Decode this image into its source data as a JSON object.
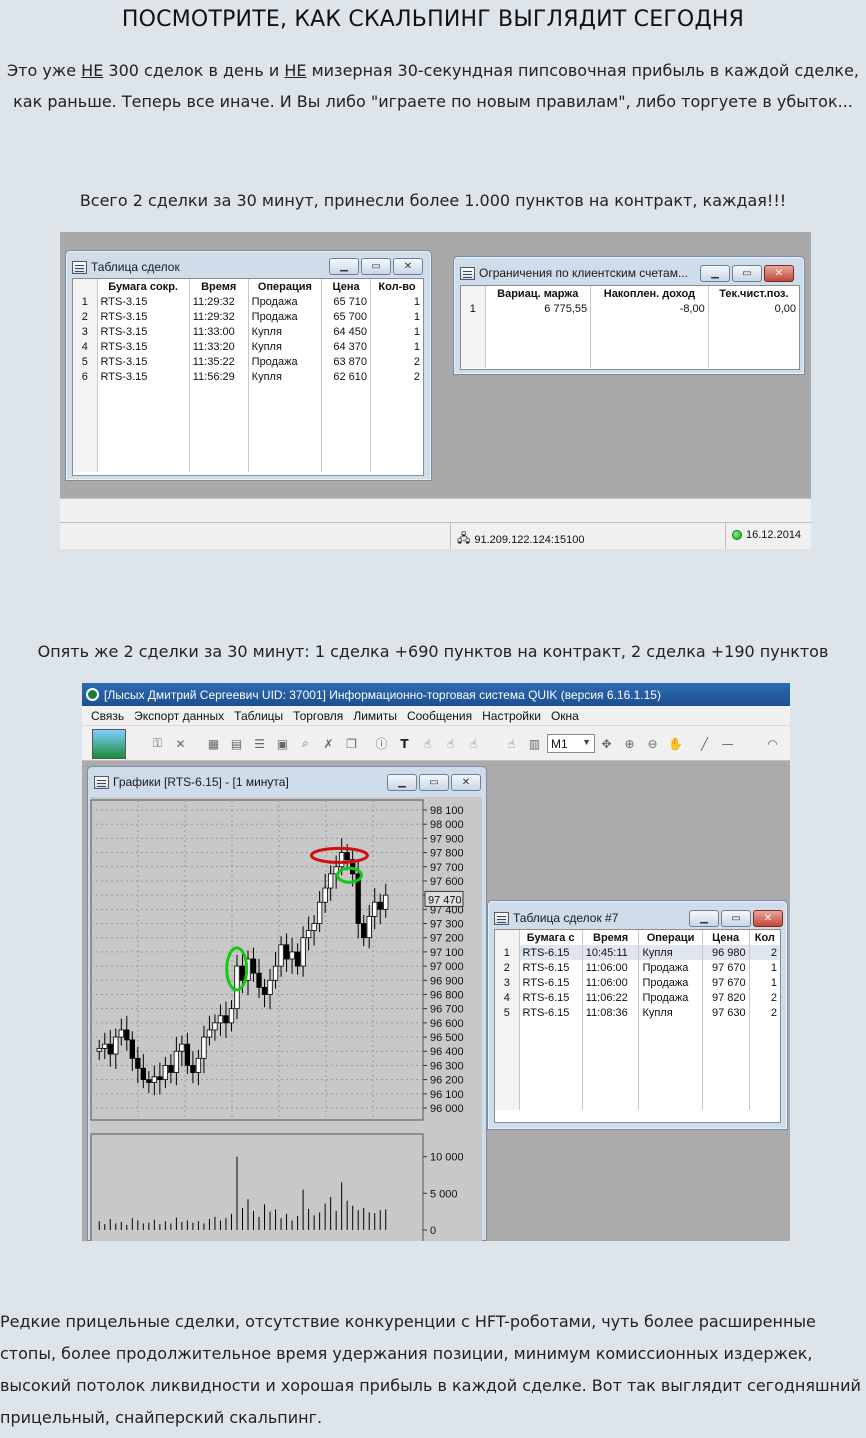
{
  "heading": "ПОСМОТРИТЕ, КАК СКАЛЬПИНГ ВЫГЛЯДИТ СЕГОДНЯ",
  "intro": {
    "line1_a": "Это уже ",
    "line1_ne1": "НЕ",
    "line1_b": " 300 сделок в день и ",
    "line1_ne2": "НЕ",
    "line1_c": " мизерная 30-секундная пипсовочная прибыль в каждой сделке,",
    "line2": "как раньше. Теперь все иначе. И Вы либо \"играете по новым правилам\", либо торгуете в убыток..."
  },
  "caption1": "Всего 2 сделки за 30 минут, принесли более 1.000 пунктов на контракт, каждая!!!",
  "screenshot1": {
    "deals_window": {
      "title": "Таблица сделок",
      "columns": [
        "Бумага сокр.",
        "Время",
        "Операция",
        "Цена",
        "Кол-во"
      ],
      "rows": [
        {
          "n": "1",
          "sec": "RTS-3.15",
          "time": "11:29:32",
          "op": "Продажа",
          "price": "65 710",
          "qty": "1"
        },
        {
          "n": "2",
          "sec": "RTS-3.15",
          "time": "11:29:32",
          "op": "Продажа",
          "price": "65 700",
          "qty": "1"
        },
        {
          "n": "3",
          "sec": "RTS-3.15",
          "time": "11:33:00",
          "op": "Купля",
          "price": "64 450",
          "qty": "1"
        },
        {
          "n": "4",
          "sec": "RTS-3.15",
          "time": "11:33:20",
          "op": "Купля",
          "price": "64 370",
          "qty": "1"
        },
        {
          "n": "5",
          "sec": "RTS-3.15",
          "time": "11:35:22",
          "op": "Продажа",
          "price": "63 870",
          "qty": "2"
        },
        {
          "n": "6",
          "sec": "RTS-3.15",
          "time": "11:56:29",
          "op": "Купля",
          "price": "62 610",
          "qty": "2"
        }
      ]
    },
    "limits_window": {
      "title": "Ограничения по клиентским счетам...",
      "columns": [
        "Вариац. маржа",
        "Накоплен. доход",
        "Тек.чист.поз."
      ],
      "row": {
        "n": "1",
        "margin": "6 775,55",
        "income": "-8,00",
        "pos": "0,00"
      }
    },
    "status_ip": "91.209.122.124:15100",
    "status_date": "16.12.2014"
  },
  "caption2": "Опять же 2 сделки за 30 минут: 1 сделка +690 пунктов на контракт, 2 сделка +190 пунктов",
  "screenshot2": {
    "app_title": "[Лысых Дмитрий Сергеевич UID: 37001] Информационно-торговая система QUIK (версия 6.16.1.15)",
    "menu": [
      "Связь",
      "Экспорт данных",
      "Таблицы",
      "Торговля",
      "Лимиты",
      "Сообщения",
      "Настройки",
      "Окна"
    ],
    "timeframe_select": "M1",
    "chart_window_title": "Графики [RTS-6.15] - [1 минута]",
    "price_ticks": [
      "98 100",
      "98 000",
      "97 900",
      "97 800",
      "97 700",
      "97 600",
      "97 500",
      "97 400",
      "97 300",
      "97 200",
      "97 100",
      "97 000",
      "96 900",
      "96 800",
      "96 700",
      "96 600",
      "96 500",
      "96 400",
      "96 300",
      "96 200",
      "96 100",
      "96 000"
    ],
    "last_price_label": "97 470",
    "volume_ticks": [
      "10 000",
      "5 000",
      "0"
    ],
    "deals_window": {
      "title": "Таблица сделок #7",
      "columns": [
        "Бумага с",
        "Время",
        "Операци",
        "Цена",
        "Кол"
      ],
      "rows": [
        {
          "n": "1",
          "sec": "RTS-6.15",
          "time": "10:45:11",
          "op": "Купля",
          "price": "96 980",
          "qty": "2"
        },
        {
          "n": "2",
          "sec": "RTS-6.15",
          "time": "11:06:00",
          "op": "Продажа",
          "price": "97 670",
          "qty": "1"
        },
        {
          "n": "3",
          "sec": "RTS-6.15",
          "time": "11:06:00",
          "op": "Продажа",
          "price": "97 670",
          "qty": "1"
        },
        {
          "n": "4",
          "sec": "RTS-6.15",
          "time": "11:06:22",
          "op": "Продажа",
          "price": "97 820",
          "qty": "2"
        },
        {
          "n": "5",
          "sec": "RTS-6.15",
          "time": "11:08:36",
          "op": "Купля",
          "price": "97 630",
          "qty": "2"
        }
      ]
    }
  },
  "outro": "Редкие прицельные сделки, отсутствие конкуренции с HFT-роботами, чуть более расширенные стопы, более продолжительное время удержания позиции, минимум комиссионных издержек, высокий потолок ликвидности и хорошая прибыль в каждой сделке. Вот так выглядит сегодняшний прицельный, снайперский скальпинг.",
  "colors": {
    "page_bg": "#dde4ea",
    "quik_titlebar": "#1d4f8f",
    "win_frame": "#cfdcea",
    "marker_red": "#d01010",
    "marker_green": "#14c814"
  }
}
